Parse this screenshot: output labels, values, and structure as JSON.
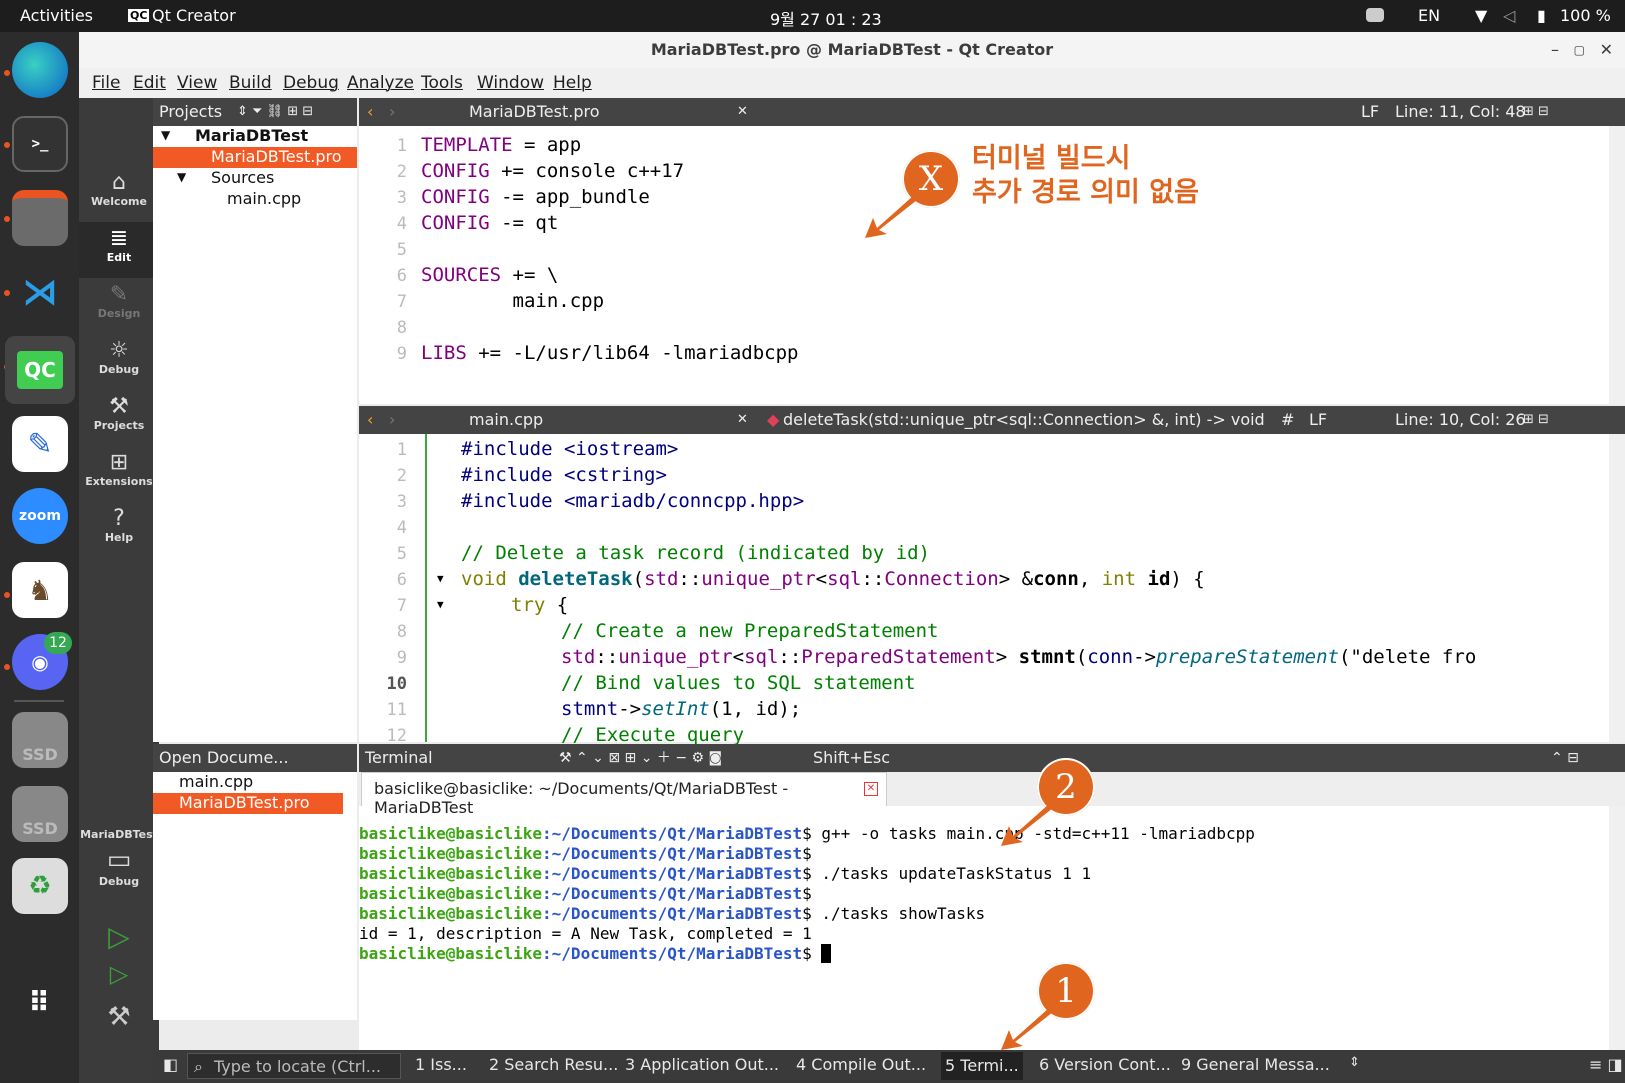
{
  "topbar": {
    "activities": "Activities",
    "app": "Qt Creator",
    "clock": "9월 27  01 : 23",
    "lang": "EN",
    "battery": "100 %"
  },
  "dock": {
    "discord_badge": "12",
    "ssd1": "SSD",
    "ssd2": "SSD"
  },
  "window": {
    "title": "MariaDBTest.pro @ MariaDBTest - Qt Creator"
  },
  "menu": [
    "File",
    "Edit",
    "View",
    "Build",
    "Debug",
    "Analyze",
    "Tools",
    "Window",
    "Help"
  ],
  "modes": [
    "Welcome",
    "Edit",
    "Design",
    "Debug",
    "Projects",
    "Extensions",
    "Help"
  ],
  "kit": {
    "project": "MariaDBTest",
    "mode": "Debug"
  },
  "projects": {
    "header": "Projects",
    "items": [
      "MariaDBTest",
      "MariaDBTest.pro",
      "Sources",
      "main.cpp"
    ]
  },
  "open_documents": {
    "header": "Open Docume...",
    "items": [
      "main.cpp",
      "MariaDBTest.pro"
    ]
  },
  "editor1": {
    "file": "MariaDBTest.pro",
    "lf": "LF",
    "pos": "Line: 11, Col: 48",
    "lines": [
      {
        "n": "1",
        "t": "TEMPLATE = app"
      },
      {
        "n": "2",
        "t": "CONFIG += console c++17"
      },
      {
        "n": "3",
        "t": "CONFIG -= app_bundle"
      },
      {
        "n": "4",
        "t": "CONFIG -= qt"
      },
      {
        "n": "5",
        "t": ""
      },
      {
        "n": "6",
        "t": "SOURCES += \\"
      },
      {
        "n": "7",
        "t": "        main.cpp"
      },
      {
        "n": "8",
        "t": ""
      },
      {
        "n": "9",
        "t": "LIBS += -L/usr/lib64 -lmariadbcpp"
      }
    ]
  },
  "editor2": {
    "file": "main.cpp",
    "symbol": "deleteTask(std::unique_ptr<sql::Connection> &, int) -> void",
    "hash": "#",
    "lf": "LF",
    "pos": "Line: 10, Col: 26",
    "linenos": [
      "1",
      "2",
      "3",
      "4",
      "5",
      "6",
      "7",
      "8",
      "9",
      "10",
      "11",
      "12"
    ]
  },
  "annotation": {
    "x": "X",
    "line1": "터미널 빌드시",
    "line2": "추가 경로 의미 없음",
    "m1": "1",
    "m2": "2"
  },
  "terminal": {
    "panel": "Terminal",
    "shortcut": "Shift+Esc",
    "tab": "basiclike@basiclike: ~/Documents/Qt/MariaDBTest - MariaDBTest",
    "user": "basiclike@basiclike",
    "path": ":~/Documents/Qt/MariaDBTest",
    "cmds": [
      "$ g++ -o tasks main.cpp -std=c++11 -lmariadbcpp",
      "$",
      "$ ./tasks updateTaskStatus 1 1",
      "$",
      "$ ./tasks showTasks"
    ],
    "output": "id = 1, description = A New Task, completed = 1",
    "last": "$ "
  },
  "statusbar": {
    "locate": "Type to locate (Ctrl...",
    "tabs": [
      "1  Iss...",
      "2  Search Resu...",
      "3  Application Out...",
      "4  Compile Out...",
      "5  Termi...",
      "6  Version Cont...",
      "9  General Messa..."
    ]
  }
}
